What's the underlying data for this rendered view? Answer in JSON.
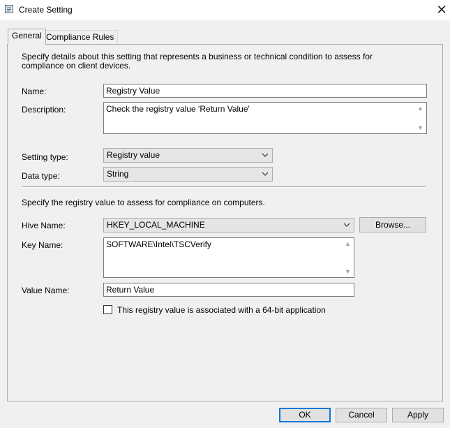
{
  "window": {
    "title": "Create Setting",
    "icon": "settings-window-icon",
    "close_glyph": "✕"
  },
  "tabs": [
    {
      "label": "General",
      "active": true
    },
    {
      "label": "Compliance Rules",
      "active": false
    }
  ],
  "general": {
    "intro": "Specify details about this setting that represents a business or technical condition to assess for compliance on client devices.",
    "name_label": "Name:",
    "name_value": "Registry Value",
    "description_label": "Description:",
    "description_value": "Check the registry value 'Return Value'",
    "setting_type_label": "Setting type:",
    "setting_type_value": "Registry value",
    "data_type_label": "Data type:",
    "data_type_value": "String"
  },
  "registry": {
    "intro": "Specify the registry value to assess for compliance on computers.",
    "hive_label": "Hive Name:",
    "hive_value": "HKEY_LOCAL_MACHINE",
    "browse_label": "Browse...",
    "key_label": "Key Name:",
    "key_value": "SOFTWARE\\Intel\\TSCVerify",
    "value_name_label": "Value Name:",
    "value_name_value": "Return Value",
    "is64_label": "This registry value is associated with a 64-bit application",
    "is64_checked": false
  },
  "footer": {
    "ok_label": "OK",
    "cancel_label": "Cancel",
    "apply_label": "Apply"
  },
  "colors": {
    "focus_border": "#0078d7",
    "dialog_bg": "#f0f0f0"
  }
}
